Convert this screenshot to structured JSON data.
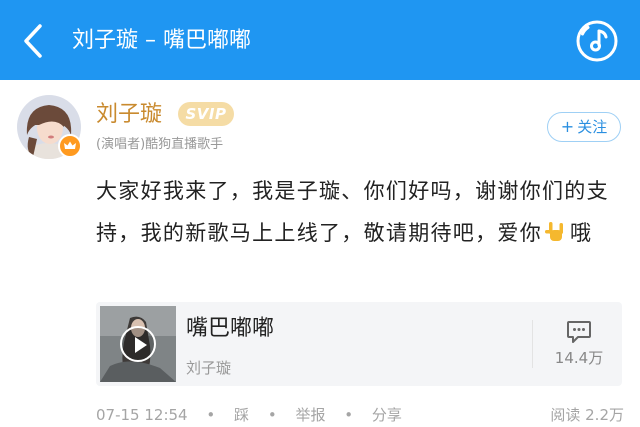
{
  "header": {
    "title": "刘子璇 – 嘴巴嘟嘟",
    "back_icon": "chevron-left-icon",
    "music_icon": "music-note-icon",
    "background_color": "#1f96f2"
  },
  "post": {
    "user_name": "刘子璇",
    "vip_badge": "SVIP",
    "user_subtitle": "(演唱者)酷狗直播歌手",
    "follow_label": "关注",
    "follow_plus": "+",
    "text_before_emoji": "大家好我来了，我是子璇、你们好吗，谢谢你们的支持，我的新歌马上上线了，敬请期待吧，爱你",
    "emoji": "love-you-hand-emoji",
    "text_after_emoji": "哦",
    "name_color": "#c98a2e"
  },
  "song_card": {
    "title": "嘴巴嘟嘟",
    "artist": "刘子璇",
    "comment_icon": "comment-icon",
    "comment_count": "14.4万"
  },
  "footer": {
    "timestamp": "07-15 12:54",
    "dot": "•",
    "dislike": "踩",
    "report": "举报",
    "share": "分享",
    "read_count": "阅读 2.2万"
  }
}
